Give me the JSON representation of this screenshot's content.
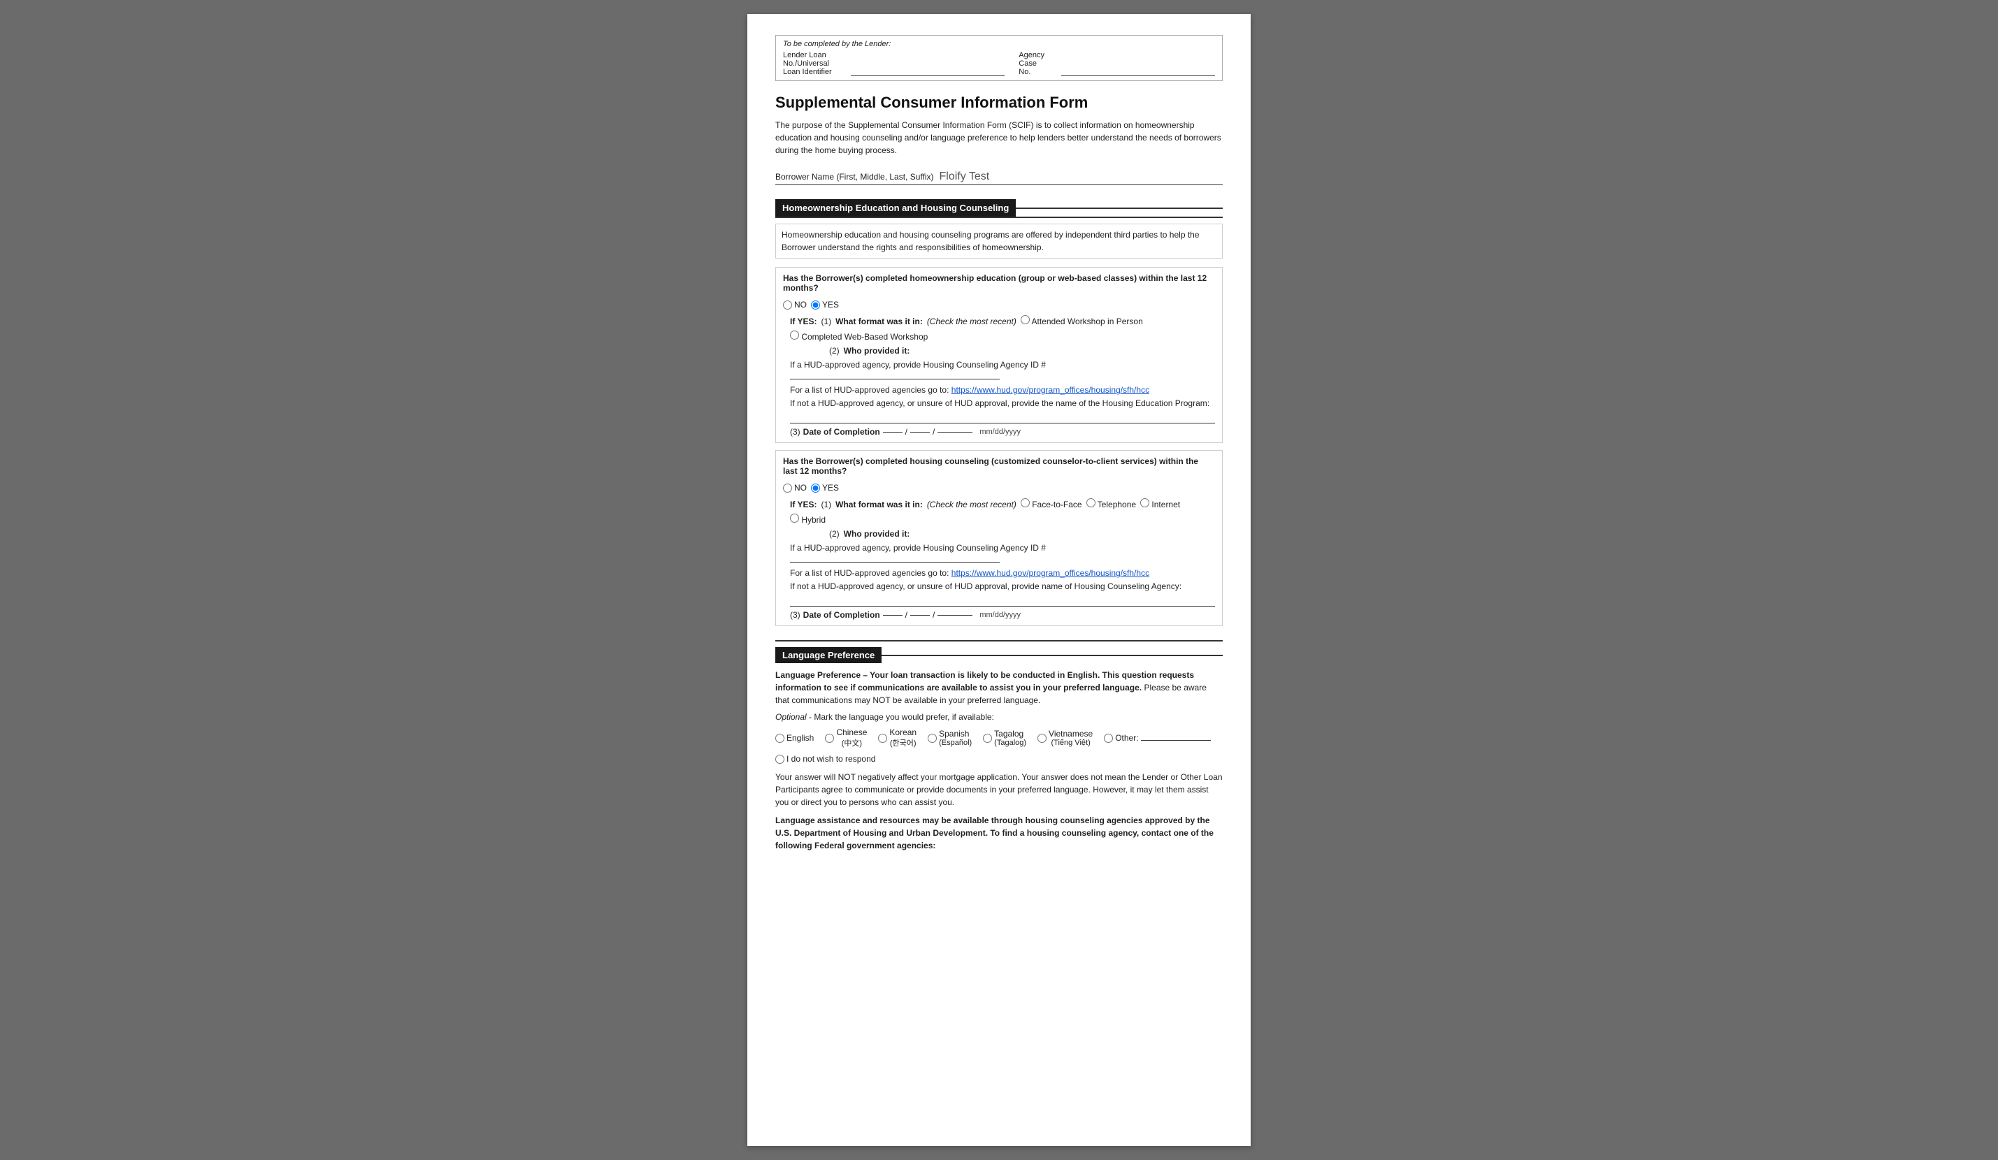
{
  "lender": {
    "label": "To be completed by the Lender:",
    "loan_label": "Lender Loan No./Universal Loan Identifier",
    "agency_label": "Agency Case No."
  },
  "form": {
    "title": "Supplemental Consumer Information Form",
    "description": "The purpose of the Supplemental Consumer Information Form (SCIF) is to collect information on homeownership education and housing counseling and/or language preference to help lenders better understand the needs of borrowers during the home buying process.",
    "borrower_name_label": "Borrower Name (First, Middle, Last, Suffix)",
    "borrower_name_value": "Floify Test"
  },
  "homeownership": {
    "section_title": "Homeownership Education and Housing Counseling",
    "section_description": "Homeownership education and housing counseling programs are offered by independent third parties to help the Borrower understand the rights and responsibilities of homeownership.",
    "q1": {
      "text": "Has the Borrower(s) completed homeownership education (group or web-based classes) within the last 12 months?",
      "no_label": "NO",
      "yes_label": "YES",
      "yes_selected": true,
      "if_yes_label": "If YES:",
      "format_prefix": "(1)",
      "format_label": "What format was it in:",
      "format_hint": "(Check the most recent)",
      "format_option1": "Attended Workshop in Person",
      "format_option2": "Completed Web-Based Workshop",
      "provided_prefix": "(2)",
      "provided_label": "Who provided it:",
      "hud_text": "If a HUD-approved agency, provide Housing Counseling Agency ID #",
      "hud_link_pre": "For a list of HUD-approved agencies go to:",
      "hud_link": "https://www.hud.gov/program_offices/housing/sfh/hcc",
      "not_hud_text": "If not a HUD-approved agency, or unsure of HUD approval, provide the name of the Housing Education Program:",
      "date_prefix": "(3)",
      "date_label": "Date of Completion",
      "date_format": "mm/dd/yyyy"
    },
    "q2": {
      "text": "Has the Borrower(s) completed housing counseling (customized counselor-to-client services) within the last 12 months?",
      "no_label": "NO",
      "yes_label": "YES",
      "yes_selected": true,
      "if_yes_label": "If YES:",
      "format_prefix": "(1)",
      "format_label": "What format was it in:",
      "format_hint": "(Check the most recent)",
      "format_option1": "Face-to-Face",
      "format_option2": "Telephone",
      "format_option3": "Internet",
      "format_option4": "Hybrid",
      "provided_prefix": "(2)",
      "provided_label": "Who provided it:",
      "hud_text": "If a HUD-approved agency, provide Housing Counseling Agency ID #",
      "hud_link_pre": "For a list of HUD-approved agencies go to:",
      "hud_link": "https://www.hud.gov/program_offices/housing/sfh/hcc",
      "not_hud_text": "If not a HUD-approved agency, or unsure of HUD approval, provide name of Housing Counseling Agency:",
      "date_prefix": "(3)",
      "date_label": "Date of Completion",
      "date_format": "mm/dd/yyyy"
    }
  },
  "language": {
    "section_title": "Language Preference",
    "description_bold": "Language Preference – Your loan transaction is likely to be conducted in English. This question requests information to see if communications are available to assist you in your preferred language.",
    "description_normal": "Please be aware that communications may NOT be available in your preferred language.",
    "optional_label": "Optional",
    "optional_text": "- Mark the language you would prefer, if available:",
    "choices": [
      {
        "label": "English",
        "sub": "",
        "id": "lang-english"
      },
      {
        "label": "Chinese",
        "sub": "(中文)",
        "id": "lang-chinese"
      },
      {
        "label": "Korean",
        "sub": "(한국어)",
        "id": "lang-korean"
      },
      {
        "label": "Spanish",
        "sub": "(Español)",
        "id": "lang-spanish"
      },
      {
        "label": "Tagalog",
        "sub": "(Tagalog)",
        "id": "lang-tagalog"
      },
      {
        "label": "Vietnamese",
        "sub": "(Tiếng Việt)",
        "id": "lang-vietnamese"
      },
      {
        "label": "Other:",
        "sub": "",
        "id": "lang-other"
      },
      {
        "label": "I do not wish to respond",
        "sub": "",
        "id": "lang-no-respond"
      }
    ],
    "note": "Your answer will NOT negatively affect your mortgage application. Your answer does not mean the Lender or Other Loan Participants agree to communicate or provide documents in your preferred language. However, it may let them assist you or direct you to persons who can assist you.",
    "assistance_bold": "Language assistance and resources may be available through housing counseling agencies approved by the U.S. Department of Housing and Urban Development. To find a housing counseling agency, contact one of the following Federal government agencies:"
  }
}
